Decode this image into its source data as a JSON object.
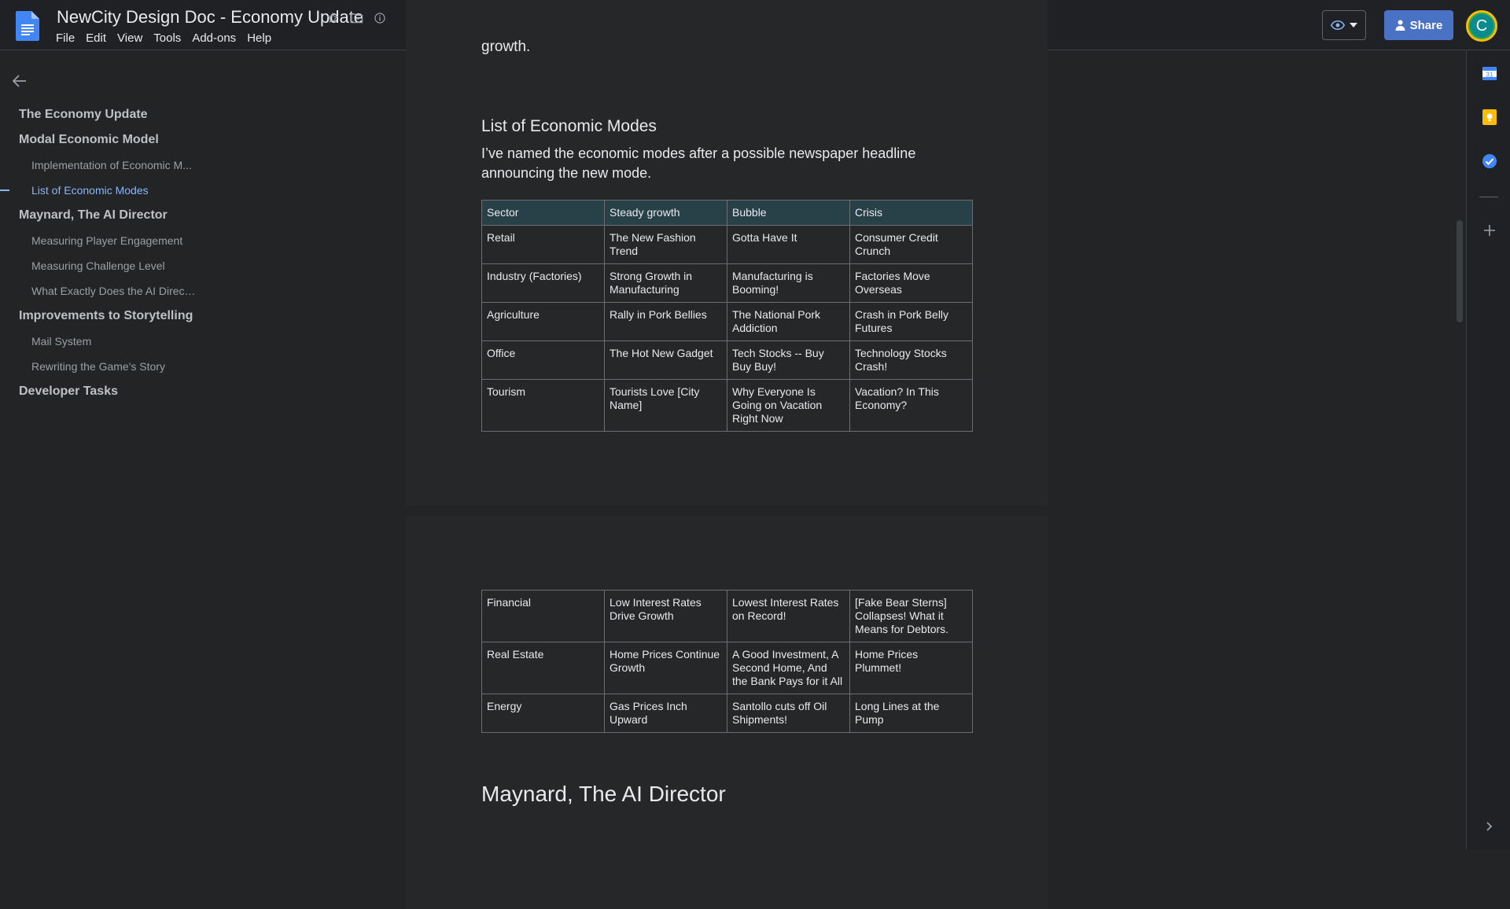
{
  "header": {
    "doc_title": "NewCity Design Doc - Economy Update",
    "menu": [
      "File",
      "Edit",
      "View",
      "Tools",
      "Add-ons",
      "Help"
    ],
    "share_label": "Share",
    "avatar_letter": "C"
  },
  "outline": {
    "items": [
      {
        "label": "The Economy Update",
        "level": 1
      },
      {
        "label": "Modal Economic Model",
        "level": 1
      },
      {
        "label": "Implementation of Economic M...",
        "level": 2
      },
      {
        "label": "List of Economic Modes",
        "level": 2,
        "active": true
      },
      {
        "label": "Maynard, The AI Director",
        "level": 1
      },
      {
        "label": "Measuring Player Engagement",
        "level": 2
      },
      {
        "label": "Measuring Challenge Level",
        "level": 2
      },
      {
        "label": "What Exactly Does the AI Direct...",
        "level": 2
      },
      {
        "label": "Improvements to Storytelling",
        "level": 1
      },
      {
        "label": "Mail System",
        "level": 2
      },
      {
        "label": "Rewriting the Game's Story",
        "level": 2
      },
      {
        "label": "Developer Tasks",
        "level": 1
      }
    ]
  },
  "document": {
    "partial_text": "growth.",
    "modes_heading": "List of Economic Modes",
    "modes_paragraph": "I’ve named the economic modes after a possible newspaper headline announcing the new mode.",
    "table_header": [
      "Sector",
      "Steady growth",
      "Bubble",
      "Crisis"
    ],
    "table_rows_page1": [
      [
        "Retail",
        "The New Fashion Trend",
        "Gotta Have It",
        "Consumer Credit Crunch"
      ],
      [
        "Industry (Factories)",
        "Strong Growth in Manufacturing",
        "Manufacturing is Booming!",
        "Factories Move Overseas"
      ],
      [
        "Agriculture",
        "Rally in Pork Bellies",
        "The National Pork Addiction",
        "Crash in Pork Belly Futures"
      ],
      [
        "Office",
        "The Hot New Gadget",
        "Tech Stocks -- Buy Buy Buy!",
        "Technology Stocks Crash!"
      ],
      [
        "Tourism",
        "Tourists Love [City Name]",
        "Why Everyone Is Going on Vacation Right Now",
        "Vacation? In This Economy?"
      ]
    ],
    "table_rows_page2": [
      [
        "Financial",
        "Low Interest Rates Drive Growth",
        "Lowest Interest Rates on Record!",
        "[Fake Bear Sterns] Collapses! What it Means for Debtors."
      ],
      [
        "Real Estate",
        "Home Prices Continue Growth",
        "A Good Investment, A Second Home, And the Bank Pays for it All",
        "Home Prices Plummet!"
      ],
      [
        "Energy",
        "Gas Prices Inch Upward",
        "Santollo cuts off Oil Shipments!",
        "Long Lines at the Pump"
      ]
    ],
    "maynard_heading": "Maynard, The AI Director"
  },
  "colors": {
    "accent_blue": "#8ab4f8",
    "share_button": "#4a72c4",
    "table_header_bg": "#284048"
  }
}
